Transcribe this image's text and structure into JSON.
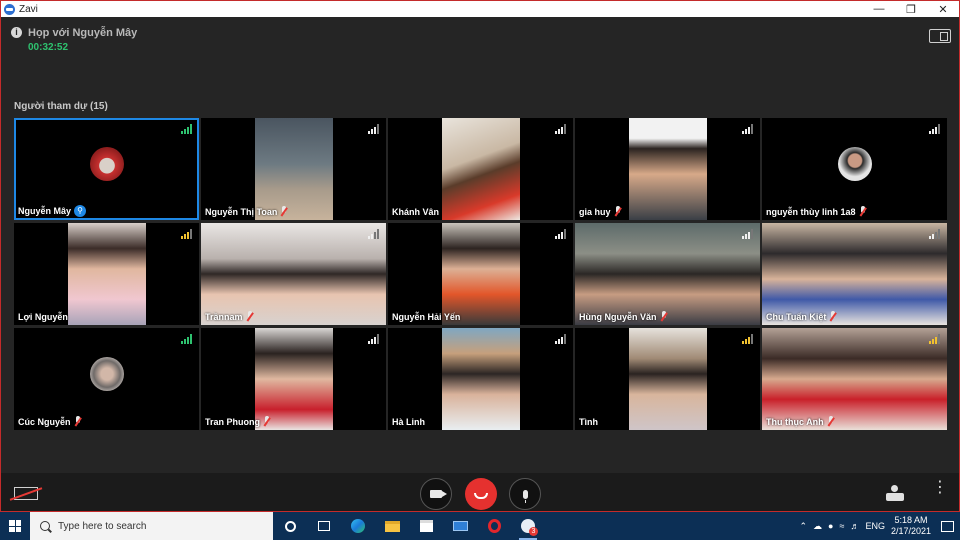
{
  "window": {
    "title": "Zavi"
  },
  "header": {
    "meeting_title": "Họp với Nguyễn Mây",
    "timer": "00:32:52",
    "participants_label": "Người tham dự (15)"
  },
  "participants": [
    {
      "name": "Nguyễn Mây",
      "pinned": true,
      "muted": false,
      "signal": "green"
    },
    {
      "name": "Nguyễn Thị Toan",
      "muted": true,
      "signal": "high"
    },
    {
      "name": "Khánh Vân",
      "muted": false,
      "signal": "high"
    },
    {
      "name": "gia huy",
      "muted": true,
      "signal": "high"
    },
    {
      "name": "nguyễn thùy linh 1a8",
      "muted": true,
      "signal": "high"
    },
    {
      "name": "Lợi Nguyễn",
      "muted": false,
      "signal": "yellow"
    },
    {
      "name": "Trầnnam",
      "muted": true,
      "signal": "half"
    },
    {
      "name": "Nguyễn Hải Yến",
      "muted": false,
      "signal": "high"
    },
    {
      "name": "Hùng Nguyễn Văn",
      "muted": true,
      "signal": "high"
    },
    {
      "name": "Chu Tuấn Kiệt",
      "muted": true,
      "signal": "half"
    },
    {
      "name": "Cúc Nguyễn",
      "muted": true,
      "signal": "green"
    },
    {
      "name": "Tran Phuong",
      "muted": true,
      "signal": "high"
    },
    {
      "name": "Hà Linh",
      "muted": false,
      "signal": "high"
    },
    {
      "name": "Tình",
      "muted": false,
      "signal": "yellow"
    },
    {
      "name": "Thu thục Anh",
      "muted": true,
      "signal": "yellow"
    }
  ],
  "taskbar": {
    "search_placeholder": "Type here to search",
    "language": "ENG",
    "time": "5:18 AM",
    "date": "2/17/2021",
    "notification_count": "3"
  },
  "icons": {
    "window_controls": [
      "minimize-icon",
      "restore-icon",
      "close-icon"
    ],
    "call_controls": [
      "camera-icon",
      "end-call-icon",
      "microphone-icon"
    ]
  }
}
